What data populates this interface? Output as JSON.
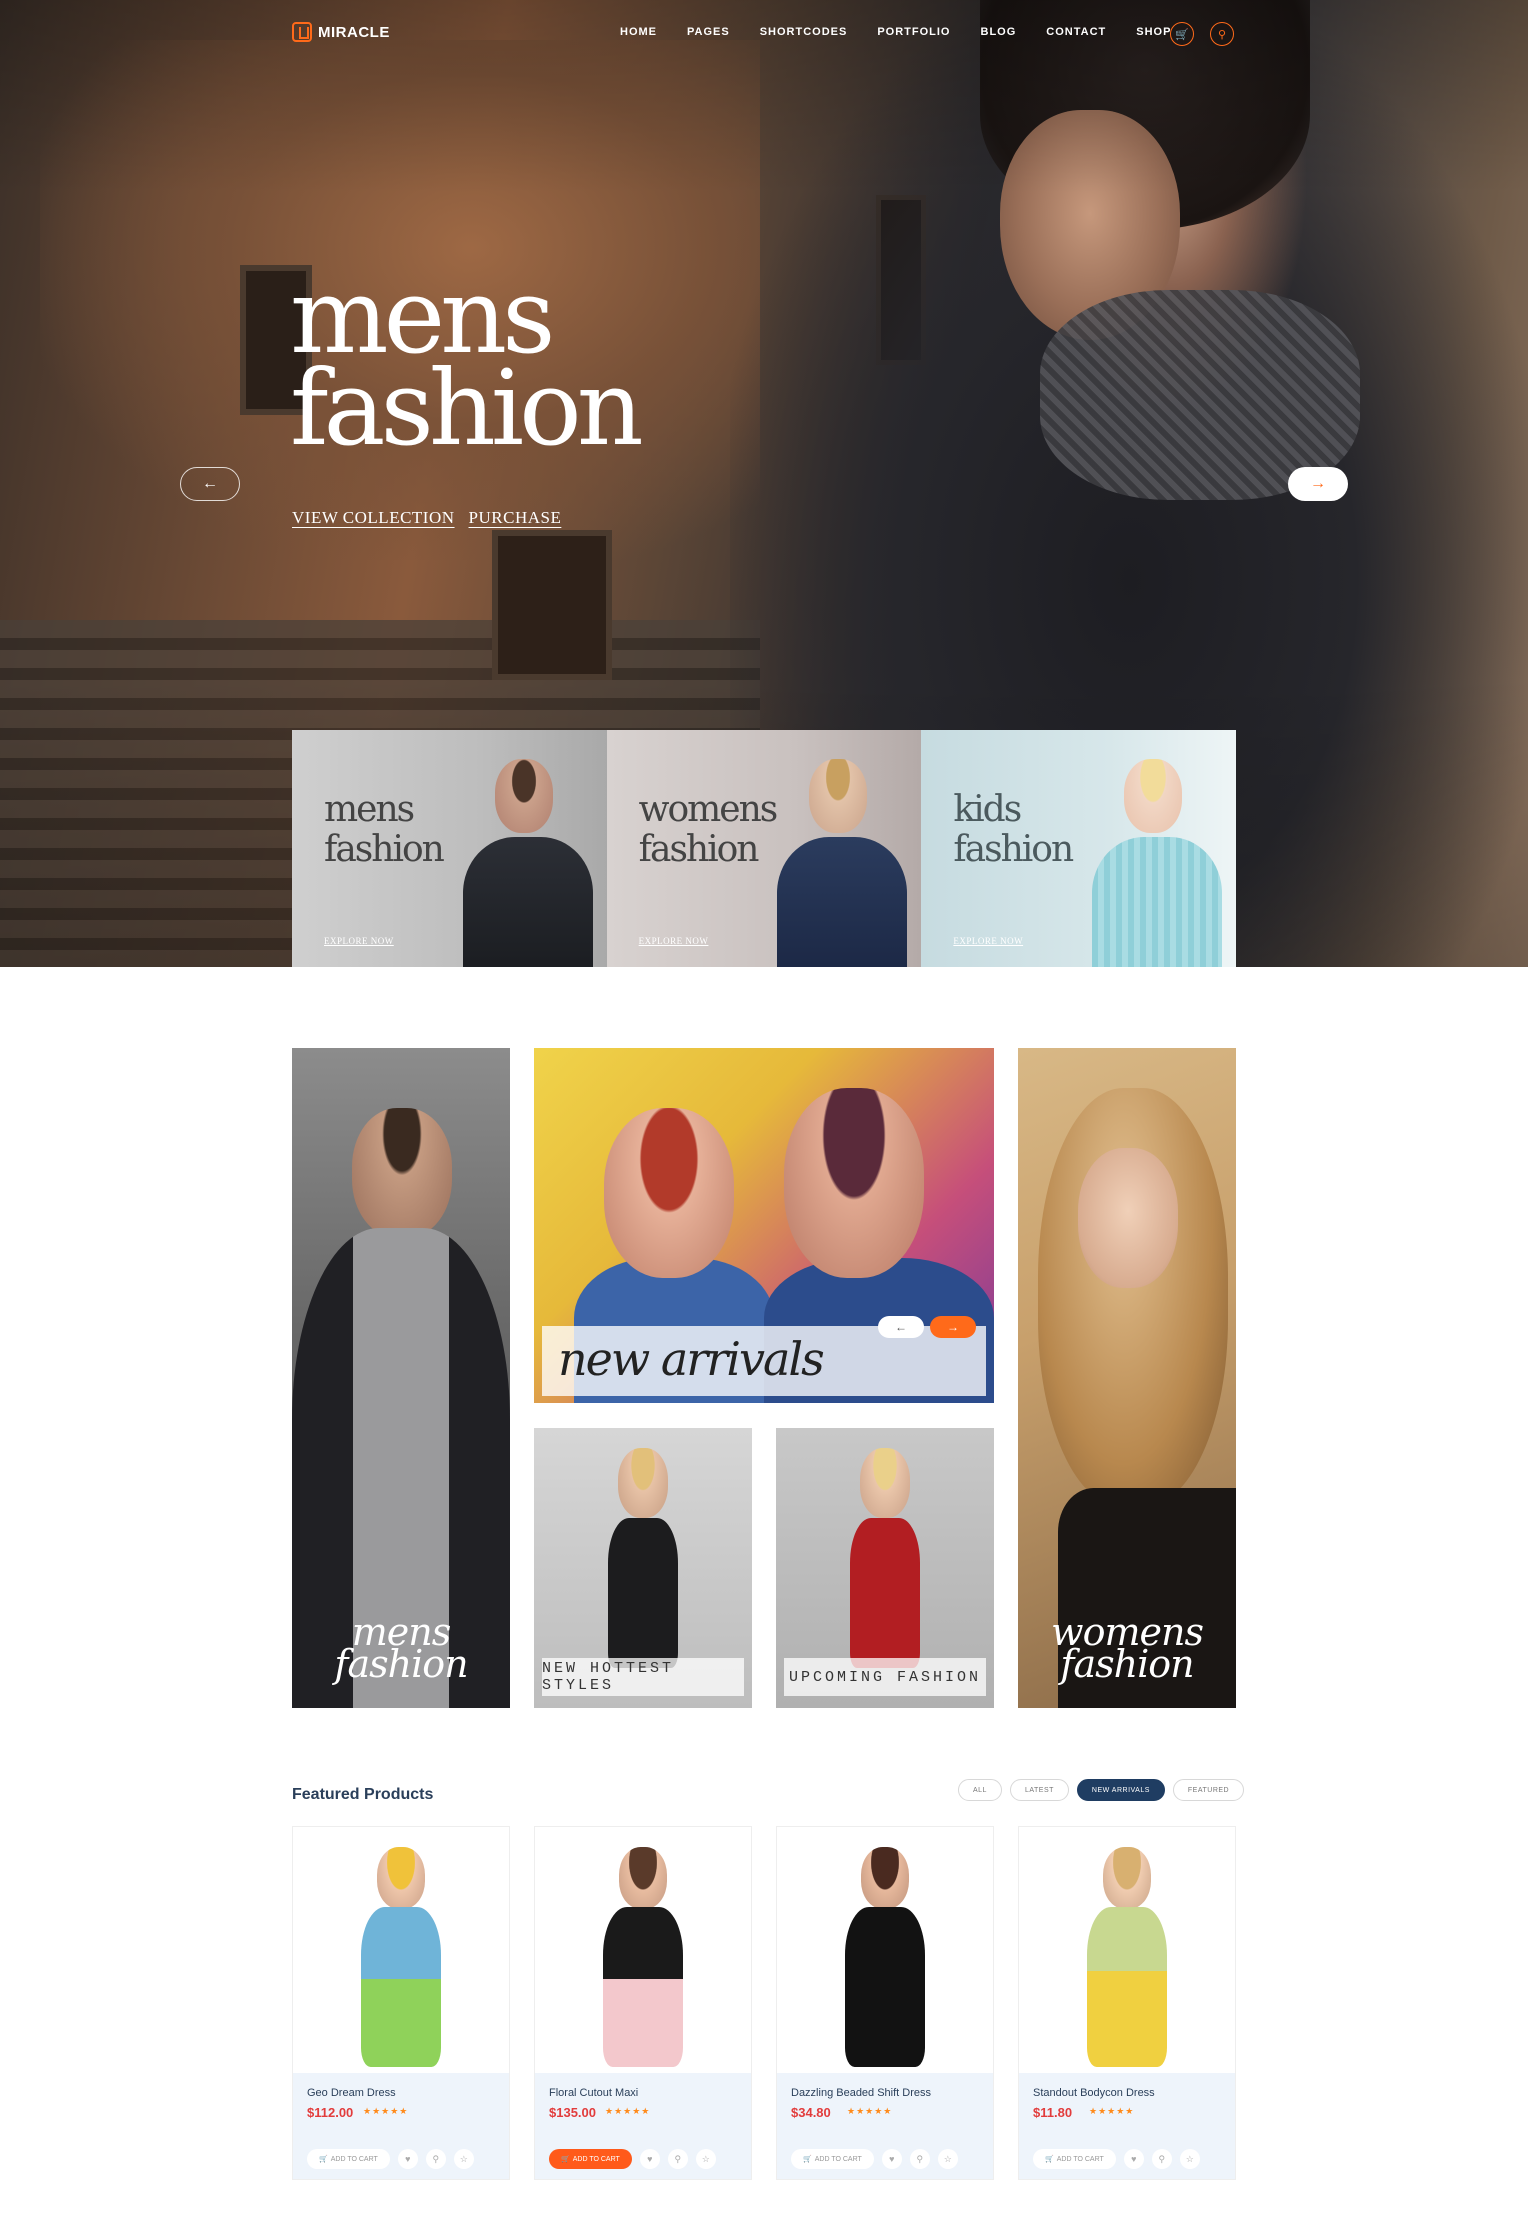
{
  "nav": {
    "brand": "MIRACLE",
    "menu": [
      "HOME",
      "PAGES",
      "SHORTCODES",
      "PORTFOLIO",
      "BLOG",
      "CONTACT",
      "SHOP"
    ],
    "cart_icon": "cart-icon",
    "search_icon": "search-icon",
    "accent": "#ff6a1a"
  },
  "hero": {
    "title_line1": "mens",
    "title_line2": "fashion",
    "link1": "VIEW COLLECTION",
    "link2": "PURCHASE",
    "prev": "←",
    "next": "→"
  },
  "categories": [
    {
      "line1": "mens",
      "line2": "fashion",
      "link": "EXPLORE NOW"
    },
    {
      "line1": "womens",
      "line2": "fashion",
      "link": "EXPLORE NOW"
    },
    {
      "line1": "kids",
      "line2": "fashion",
      "link": "EXPLORE NOW"
    }
  ],
  "grid": {
    "mens": {
      "line1": "mens",
      "line2": "fashion"
    },
    "arrivals": {
      "label": "new arrivals",
      "prev": "←",
      "next": "→"
    },
    "hottest": "NEW HOTTEST STYLES",
    "upcoming": "UPCOMING FASHION",
    "womens": {
      "line1": "womens",
      "line2": "fashion"
    }
  },
  "featured": {
    "title": "Featured Products",
    "filters": [
      "ALL",
      "LATEST",
      "NEW ARRIVALS",
      "FEATURED"
    ],
    "active_filter": "NEW ARRIVALS",
    "stars": "★★★★★",
    "products": [
      {
        "name": "Geo Dream Dress",
        "price": "$112.00",
        "cart": "ADD TO CART",
        "rating": 4
      },
      {
        "name": "Floral Cutout Maxi",
        "price": "$135.00",
        "cart": "ADD TO CART",
        "rating": 4
      },
      {
        "name": "Dazzling Beaded Shift Dress",
        "price": "$34.80",
        "cart": "ADD TO CART",
        "rating": 4
      },
      {
        "name": "Standout Bodycon Dress",
        "price": "$11.80",
        "cart": "ADD TO CART",
        "rating": 4
      }
    ]
  }
}
